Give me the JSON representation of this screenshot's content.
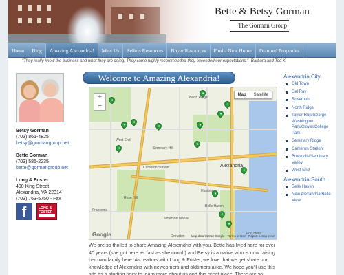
{
  "header": {
    "site_title": "Bette & Betsy Gorman",
    "site_subtitle": "The Gorman Group"
  },
  "nav": {
    "items": [
      {
        "label": "Home",
        "active": false
      },
      {
        "label": "Blog",
        "active": false
      },
      {
        "label": "Amazing Alexandria!",
        "active": true
      },
      {
        "label": "Meet Us",
        "active": false
      },
      {
        "label": "Sellers Resources",
        "active": false
      },
      {
        "label": "Buyer Resources",
        "active": false
      },
      {
        "label": "Find a New Home",
        "active": false
      },
      {
        "label": "Featured Properties",
        "active": false
      }
    ]
  },
  "testimonial": "\"They really know the business and what they are doing. They came highly recommended-they exceeded our expectations.\" -Barbara and Ted K.",
  "sidebar": {
    "contacts": [
      {
        "name": "Betsy Gorman",
        "phone": "(703) 861-4825",
        "email": "betsy@gormangroup.net"
      },
      {
        "name": "Bette Gorman",
        "phone": "(703) 585-2235",
        "email": "bette@gormangroup.net"
      }
    ],
    "office": {
      "name": "Long & Foster",
      "street": "400 King Street",
      "city": "Alexandria, VA 22314",
      "fax": "(703) 763-5750 - Fax"
    },
    "logo_text": "LONG & FOSTER"
  },
  "main": {
    "page_title": "Welcome to Amazing Alexandria!",
    "intro": "We are so thrilled to share Amazing Alexandria with you. Bette has lived here for over 40 years (she got here as fast as she could!) and Betsy is a native who is now raising her own family here.  As realtors with Long & Foster, we love that we get share our knowledge of Alexandria with newcomers and oldtimers alike.  We hope you'll use this site as a starting point to learn more about us and this great place.  There are so"
  },
  "map": {
    "type_map": "Map",
    "type_satellite": "Satellite",
    "zoom_in": "+",
    "zoom_out": "−",
    "footer": "Map data ©2013 Google · Terms of Use · Report a map error",
    "google": "Google",
    "labels": {
      "north_ridge": "North Ridge",
      "seminary_hill": "Seminary Hill",
      "alexandria": "Alexandria",
      "huntington": "Huntington",
      "rose_hill": "Rose Hill",
      "jefferson_manor": "Jefferson Manor",
      "belle_haven": "Belle Haven",
      "groveton": "Groveton",
      "franconia": "Franconia",
      "fort_hunt": "Fort Hunt",
      "west_end": "West End",
      "cameron_station": "Cameron Station"
    }
  },
  "right": {
    "city_heading": "Alexandria City",
    "city_items": [
      "Old Town",
      "Del Ray",
      "Rosemont",
      "North Ridge",
      "Taylor Run/George Washington Park/Clover/College Park",
      "Seminary Ridge",
      "Cameron Station",
      "Brookville/Seminary Valley",
      "West End"
    ],
    "south_heading": "Alexandria South",
    "south_items": [
      "Belle Haven",
      "New Alexandria/Belle View"
    ]
  },
  "colors": {
    "nav_top": "#8db2d4",
    "nav_bottom": "#5b86b1",
    "link": "#3366a6",
    "pin": "#2f9e3e",
    "title_bar": "#3e6b98"
  }
}
